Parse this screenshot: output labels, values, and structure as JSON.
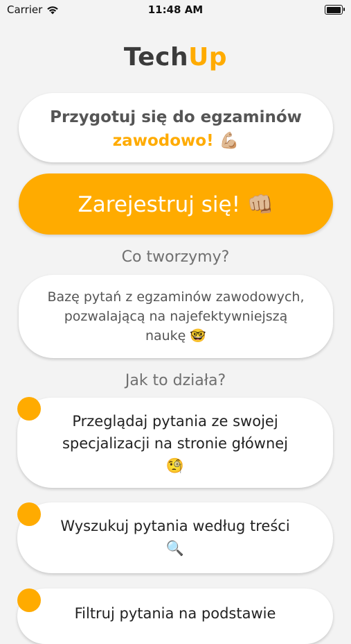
{
  "status_bar": {
    "carrier": "Carrier",
    "time": "11:48 AM",
    "battery_level": 1.0
  },
  "logo": {
    "part1": "Tech",
    "part2": "Up"
  },
  "hero": {
    "line1": "Przygotuj się do egzaminów",
    "line2": "zawodowo! 💪🏼"
  },
  "register_button": {
    "label": "Zarejestruj się! 👊🏼"
  },
  "what_we_create": {
    "title": "Co tworzymy?",
    "lines": [
      "Bazę pytań z egzaminów zawodowych,",
      "pozwalającą na najefektywniejszą",
      "naukę 🤓"
    ]
  },
  "how_it_works": {
    "title": "Jak to działa?",
    "steps": [
      {
        "lines": [
          "Przeglądaj pytania ze swojej",
          "specjalizacji na stronie głównej",
          "🧐"
        ]
      },
      {
        "lines": [
          "Wyszukuj pytania według treści",
          "🔍"
        ]
      },
      {
        "lines": [
          "Filtruj pytania na podstawie"
        ]
      }
    ]
  },
  "colors": {
    "accent": "#ffab00",
    "background": "#f3f3f3",
    "card": "#ffffff"
  },
  "icons": {
    "wifi": "wifi-icon",
    "battery": "battery-icon"
  }
}
